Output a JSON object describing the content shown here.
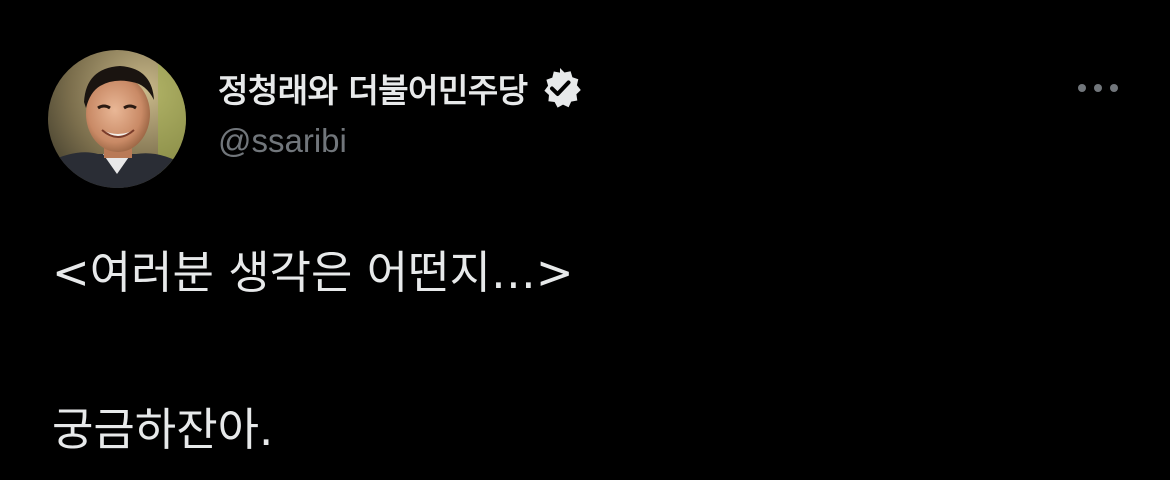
{
  "tweet": {
    "author": {
      "display_name": "정청래와 더불어민주당",
      "handle": "@ssaribi",
      "verified": true
    },
    "body_line_1": "<여러분 생각은 어떤지…>",
    "body_line_2": "궁금하잔아.",
    "more_icon": "more-horizontal-icon"
  },
  "colors": {
    "background": "#000000",
    "text": "#e7e9ea",
    "secondary": "#71767b",
    "verified_badge": "#e7e9ea"
  }
}
